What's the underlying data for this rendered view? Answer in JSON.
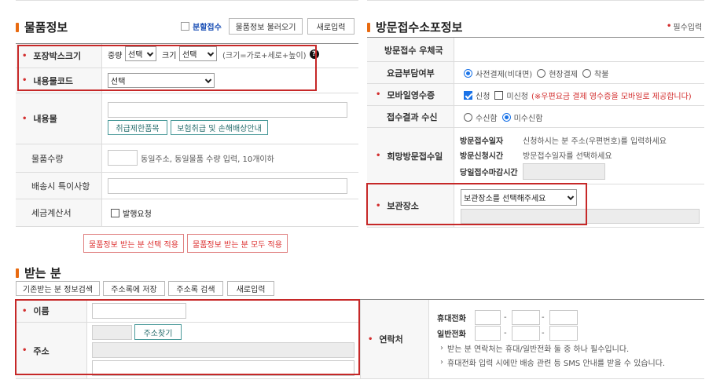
{
  "goods": {
    "title": "물품정보",
    "split_label": "분할접수",
    "load_button": "물품정보 불러오기",
    "new_button": "새로입력",
    "rows": {
      "box_size": {
        "label": "포장박스크기",
        "weight_label": "중량",
        "weight_select": "선택",
        "size_label": "크기",
        "size_select": "선택",
        "hint": "(크기=가로+세로+높이)"
      },
      "content_code": {
        "label": "내용물코드",
        "select": "선택"
      },
      "content": {
        "label": "내용물",
        "btn_restrict": "취급제한품목",
        "btn_insurance": "보험취급 및 손해배상안내"
      },
      "quantity": {
        "label": "물품수량",
        "hint": "동일주소, 동일물품 수량 입력, 10개이하"
      },
      "delivery_note": {
        "label": "배송시 특이사항"
      },
      "tax_invoice": {
        "label": "세금계산서",
        "checkbox": "발행요청"
      }
    },
    "apply_selected": "물품정보 받는 분 선택 적용",
    "apply_all": "물품정보 받는 분 모두 적용"
  },
  "visit": {
    "title": "방문접수소포정보",
    "required_note": "필수입력",
    "rows": {
      "post_office": {
        "label": "방문접수 우체국"
      },
      "fee_payer": {
        "label": "요금부담여부",
        "options": [
          "사전결제(비대면)",
          "현장결제",
          "착불"
        ],
        "selected": 0
      },
      "mobile_receipt": {
        "label": "모바일영수증",
        "opt_apply": "신청",
        "opt_no": "미신청",
        "notice": "(※우편요금 결제 영수증을 모바일로 제공합니다)"
      },
      "result_receive": {
        "label": "접수결과 수신",
        "options": [
          "수신함",
          "미수신함"
        ],
        "selected": 1
      },
      "hope_date": {
        "label": "희망방문접수일",
        "date_label": "방문접수일자",
        "date_text": "신청하시는 분 주소(우편번호)를 입력하세요",
        "time_label": "방문신청시간",
        "time_text": "방문접수일자를 선택하세요",
        "deadline_label": "당일접수마감시간"
      },
      "storage": {
        "label": "보관장소",
        "select": "보관장소를 선택해주세요"
      }
    }
  },
  "receiver": {
    "title": "받는 분",
    "buttons": [
      "기존받는 분 정보검색",
      "주소록에 저장",
      "주소록 검색",
      "새로입력"
    ],
    "name_label": "이름",
    "address_label": "주소",
    "find_address": "주소찾기",
    "contact_label": "연락처",
    "mobile_label": "휴대전화",
    "phone_label": "일반전화",
    "dash": "-",
    "notes": [
      "받는 분 연락처는 휴대/일반전화 둘 중 하나 필수입니다.",
      "휴대전화 입력 시에만 배송 관련 등 SMS 안내를 받을 수 있습니다."
    ]
  },
  "colors": {
    "required": "#d32f2f",
    "accent": "#e86a10",
    "highlight": "#c62828",
    "radio": "#1a73e8"
  }
}
